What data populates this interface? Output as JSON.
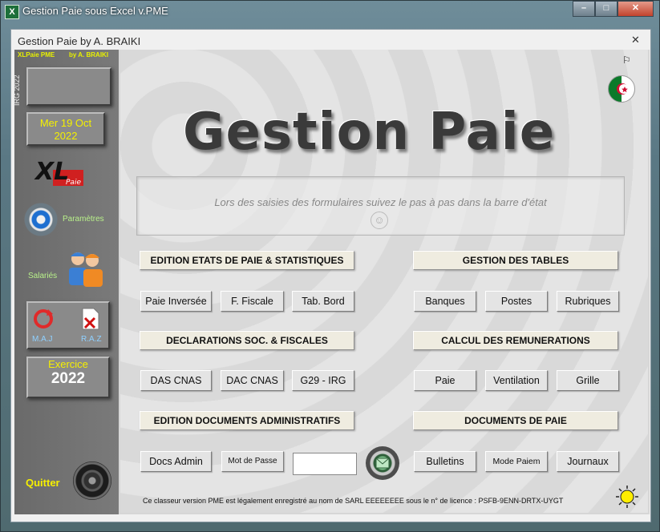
{
  "window": {
    "title": "Gestion Paie sous Excel v.PME",
    "icon_text": "X"
  },
  "form": {
    "title": "Gestion Paie by A. BRAIKI"
  },
  "sidebar": {
    "brand": "XLPaie PME",
    "author": "by A. BRAIKI",
    "vertical_tag": "IRG 2022",
    "date_line1": "Mer 19 Oct",
    "date_line2": "2022",
    "parametres_label": "Paramètres",
    "salaries_label": "Salariés",
    "maj_label": "M.A.J",
    "raz_label": "R.A.Z",
    "exercice_label": "Exercice",
    "exercice_year": "2022",
    "quit_label": "Quitter",
    "logo_text": "XL",
    "logo_sub": "Paie"
  },
  "main": {
    "logo_title": "Gestion Paie",
    "status_message": "Lors des saisies des formulaires suivez le pas à pas dans la barre d'état",
    "sections": {
      "edition_etats": "EDITION ETATS DE PAIE & STATISTIQUES",
      "gestion_tables": "GESTION DES TABLES",
      "declarations": "DECLARATIONS SOC. & FISCALES",
      "calcul_remun": "CALCUL DES REMUNERATIONS",
      "edition_docs": "EDITION DOCUMENTS ADMINISTRATIFS",
      "documents_paie": "DOCUMENTS DE PAIE"
    },
    "buttons": {
      "paie_inversee": "Paie Inversée",
      "f_fiscale": "F. Fiscale",
      "tab_bord": "Tab. Bord",
      "banques": "Banques",
      "postes": "Postes",
      "rubriques": "Rubriques",
      "das_cnas": "DAS CNAS",
      "dac_cnas": "DAC CNAS",
      "g29_irg": "G29 - IRG",
      "paie": "Paie",
      "ventilation": "Ventilation",
      "grille": "Grille",
      "docs_admin": "Docs Admin",
      "mot_de_passe": "Mot de Passe",
      "bulletins": "Bulletins",
      "mode_paiem": "Mode Paiem",
      "journaux": "Journaux"
    },
    "password_value": "",
    "license_text": "Ce classeur version PME est légalement enregistré au nom de SARL EEEEEEEE sous le n° de licence : PSFB-9ENN-DRTX-UYGT"
  },
  "colors": {
    "sidebar_yellow": "#f4f000",
    "sidebar_green": "#b8f08a",
    "section_bg": "#efece0"
  }
}
